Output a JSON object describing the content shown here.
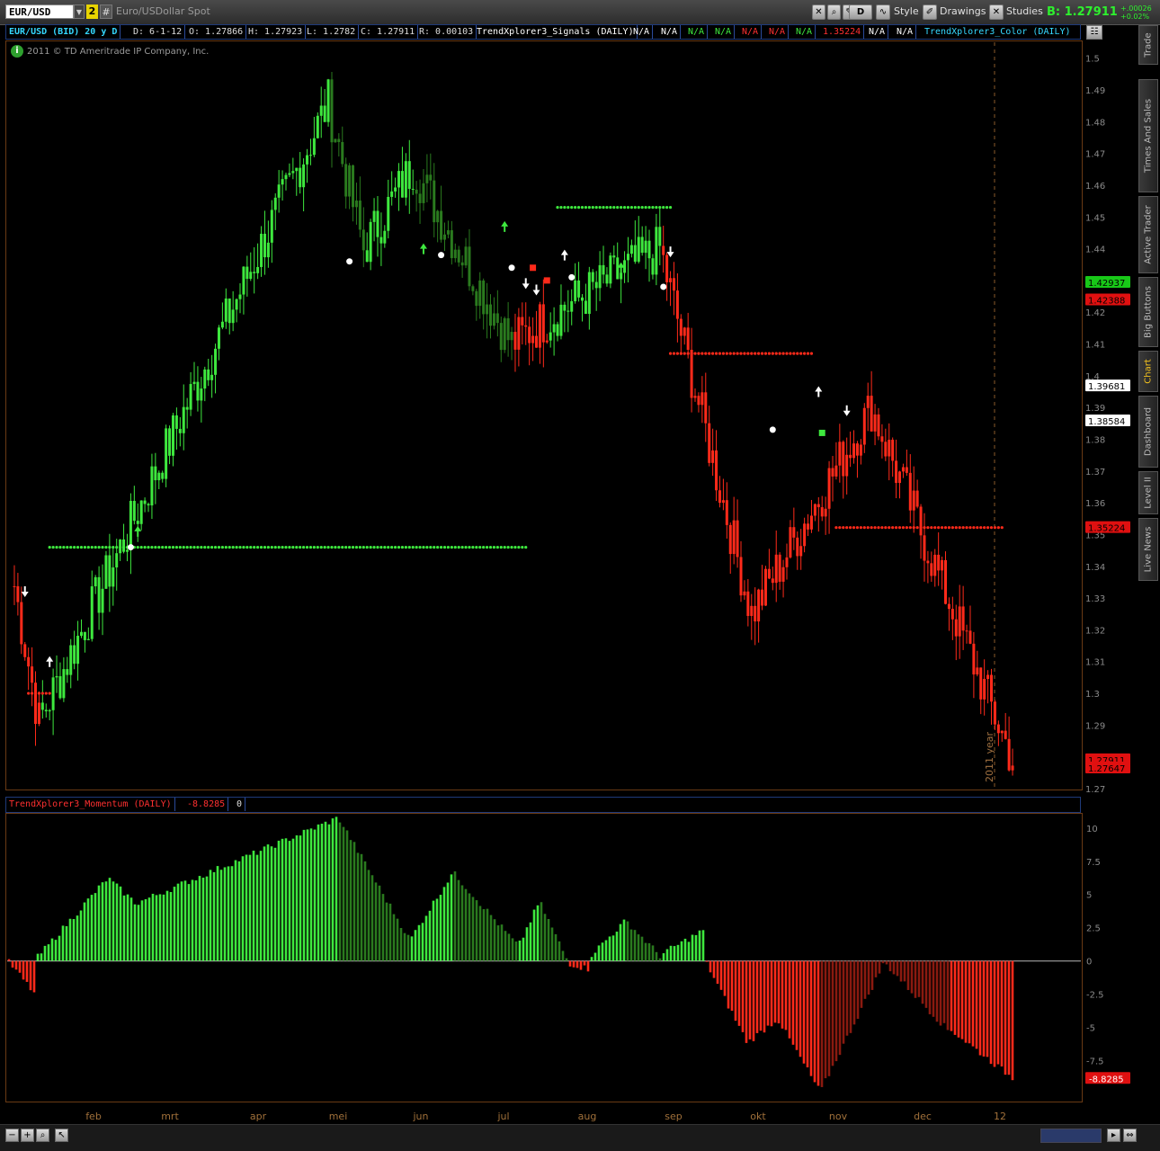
{
  "header": {
    "symbol": "EUR/USD",
    "link_badge": "2",
    "hash": "#",
    "description": "Euro/USDollar Spot",
    "period_button": "D",
    "style_label": "Style",
    "drawings_label": "Drawings",
    "studies_label": "Studies",
    "bid_label": "B: 1.27911",
    "change_abs": "+.00026",
    "change_pct": "+0.02%"
  },
  "infobar": {
    "title": "EUR/USD (BID) 20 y D",
    "date": "D: 6-1-12",
    "open": "O: 1.27866",
    "high": "H: 1.27923",
    "low": "L: 1.2782",
    "close": "C: 1.27911",
    "range": "R: 0.00103",
    "signals_study": "TrendXplorer3_Signals (DAILY)",
    "na_values": [
      "N/A",
      "N/A",
      "N/A",
      "N/A",
      "N/A",
      "N/A"
    ],
    "value_1": "1.35224",
    "na_values_2": [
      "N/A",
      "N/A"
    ],
    "color_study": "TrendXplorer3_Color (DAILY)"
  },
  "copyright": "2011 © TD Ameritrade IP Company, Inc.",
  "right_tabs": [
    "Trade",
    "Times And Sales",
    "Active Trader",
    "Big Buttons",
    "Chart",
    "Dashboard",
    "Level II",
    "Live News"
  ],
  "momentum_header": {
    "title": "TrendXplorer3_Momentum (DAILY)",
    "value": "-8.8285",
    "zero": "0"
  },
  "year_marker": "2011 year",
  "colors": {
    "bull": "#3ee83e",
    "bull_dark": "#2a7a1e",
    "bear": "#ff2a1a",
    "bear_dark": "#8a1a10",
    "axis_text": "#8a8a8a",
    "month_text": "#a0703a"
  },
  "chart_data": [
    {
      "type": "candlestick",
      "title": "EUR/USD (BID) 20 y D",
      "ylim": [
        1.27,
        1.505
      ],
      "y_ticks": [
        1.27,
        1.28,
        1.29,
        1.3,
        1.31,
        1.32,
        1.33,
        1.34,
        1.35,
        1.36,
        1.37,
        1.38,
        1.39,
        1.4,
        1.41,
        1.42,
        1.43,
        1.44,
        1.45,
        1.46,
        1.47,
        1.48,
        1.49,
        1.5
      ],
      "x_labels": [
        "feb",
        "mrt",
        "apr",
        "mei",
        "jun",
        "jul",
        "aug",
        "sep",
        "okt",
        "nov",
        "dec",
        "12"
      ],
      "price_bubbles": [
        {
          "value": "1.42937",
          "bg": "#18c818",
          "fg": "#000"
        },
        {
          "value": "1.42388",
          "bg": "#e01010",
          "fg": "#000"
        },
        {
          "value": "1.39681",
          "bg": "#ffffff",
          "fg": "#000"
        },
        {
          "value": "1.38584",
          "bg": "#ffffff",
          "fg": "#000"
        },
        {
          "value": "1.35224",
          "bg": "#e01010",
          "fg": "#000"
        },
        {
          "value": "1.27911",
          "bg": "#e01010",
          "fg": "#000"
        },
        {
          "value": "1.27647",
          "bg": "#e01010",
          "fg": "#000"
        }
      ],
      "series_segments": [
        {
          "phase": "bear",
          "from": 1.34,
          "to": 1.291
        },
        {
          "phase": "bull",
          "from": 1.291,
          "to": 1.486
        },
        {
          "phase": "bull-weak",
          "from": 1.486,
          "to": 1.44
        },
        {
          "phase": "bull",
          "from": 1.44,
          "to": 1.466
        },
        {
          "phase": "bull-weak",
          "from": 1.466,
          "to": 1.41
        },
        {
          "phase": "bear",
          "from": 1.41,
          "to": 1.418
        },
        {
          "phase": "bull",
          "from": 1.418,
          "to": 1.44
        },
        {
          "phase": "bear",
          "from": 1.44,
          "to": 1.325
        },
        {
          "phase": "bear",
          "from": 1.325,
          "to": 1.39
        },
        {
          "phase": "bear",
          "from": 1.39,
          "to": 1.279
        }
      ],
      "support_lines": [
        {
          "color": "bull",
          "y": 1.346,
          "from_day": 10,
          "to_day": 145
        },
        {
          "color": "bull",
          "y": 1.453,
          "from_day": 154,
          "to_day": 186
        },
        {
          "color": "bear",
          "y": 1.3,
          "from_day": 4,
          "to_day": 10
        },
        {
          "color": "bear",
          "y": 1.407,
          "from_day": 186,
          "to_day": 226
        },
        {
          "color": "bear",
          "y": 1.3522,
          "from_day": 233,
          "to_day": 280
        }
      ],
      "signals": [
        {
          "kind": "arrow-down-white",
          "day": 3,
          "y": 1.332
        },
        {
          "kind": "arrow-up-white",
          "day": 10,
          "y": 1.31
        },
        {
          "kind": "arrow-up-green",
          "day": 35,
          "y": 1.351
        },
        {
          "kind": "dot-white",
          "day": 33,
          "y": 1.346
        },
        {
          "kind": "dot-white",
          "day": 95,
          "y": 1.436
        },
        {
          "kind": "arrow-up-green",
          "day": 116,
          "y": 1.44
        },
        {
          "kind": "dot-white",
          "day": 121,
          "y": 1.438
        },
        {
          "kind": "arrow-up-green",
          "day": 139,
          "y": 1.447
        },
        {
          "kind": "dot-white",
          "day": 141,
          "y": 1.434
        },
        {
          "kind": "arrow-down-white",
          "day": 145,
          "y": 1.429
        },
        {
          "kind": "square-red",
          "day": 147,
          "y": 1.434
        },
        {
          "kind": "arrow-down-white",
          "day": 148,
          "y": 1.427
        },
        {
          "kind": "square-red",
          "day": 151,
          "y": 1.43
        },
        {
          "kind": "arrow-up-white",
          "day": 156,
          "y": 1.438
        },
        {
          "kind": "dot-white",
          "day": 158,
          "y": 1.431
        },
        {
          "kind": "arrow-up-green",
          "day": 172,
          "y": 1.434
        },
        {
          "kind": "dot-white",
          "day": 184,
          "y": 1.428
        },
        {
          "kind": "arrow-down-white",
          "day": 186,
          "y": 1.439
        },
        {
          "kind": "dot-white",
          "day": 215,
          "y": 1.383
        },
        {
          "kind": "arrow-up-white",
          "day": 228,
          "y": 1.395
        },
        {
          "kind": "square-green",
          "day": 229,
          "y": 1.382
        },
        {
          "kind": "arrow-down-white",
          "day": 236,
          "y": 1.389
        }
      ]
    },
    {
      "type": "bar",
      "title": "TrendXplorer3_Momentum (DAILY)",
      "ylim": [
        -10.5,
        11
      ],
      "y_ticks": [
        -7.5,
        -5,
        -2.5,
        0,
        2.5,
        5,
        7.5,
        10
      ],
      "last_value": -8.8285,
      "series_segments": [
        {
          "phase": "bear",
          "from": -0.1,
          "to": -2.4,
          "days": 8
        },
        {
          "phase": "bull",
          "from": 0.3,
          "to": 6.1,
          "days": 20
        },
        {
          "phase": "bull",
          "from": 6.1,
          "to": 4.4,
          "days": 8
        },
        {
          "phase": "bull",
          "from": 4.4,
          "to": 10.7,
          "days": 56
        },
        {
          "phase": "bull-weak",
          "from": 10.6,
          "to": 1.8,
          "days": 20
        },
        {
          "phase": "bull",
          "from": 1.8,
          "to": 6.5,
          "days": 12
        },
        {
          "phase": "bull-weak",
          "from": 6.5,
          "to": 1.3,
          "days": 18
        },
        {
          "phase": "bull",
          "from": 1.3,
          "to": 4.2,
          "days": 6
        },
        {
          "phase": "bull-weak",
          "from": 4.2,
          "to": 0.2,
          "days": 8
        },
        {
          "phase": "bear",
          "from": -0.2,
          "to": -0.6,
          "days": 6
        },
        {
          "phase": "bull",
          "from": 0.5,
          "to": 2.9,
          "days": 10
        },
        {
          "phase": "bull-weak",
          "from": 2.9,
          "to": 0.4,
          "days": 10
        },
        {
          "phase": "bull",
          "from": 0.6,
          "to": 2.3,
          "days": 12
        },
        {
          "phase": "bear",
          "from": -0.2,
          "to": -6.0,
          "days": 12
        },
        {
          "phase": "bear",
          "from": -6.0,
          "to": -4.5,
          "days": 8
        },
        {
          "phase": "bear",
          "from": -4.5,
          "to": -9.6,
          "days": 12
        },
        {
          "phase": "bear-weak",
          "from": -9.6,
          "to": -0.3,
          "days": 18
        },
        {
          "phase": "bear-weak",
          "from": -0.3,
          "to": -5.2,
          "days": 18
        },
        {
          "phase": "bear",
          "from": -5.2,
          "to": -8.8,
          "days": 18
        }
      ]
    }
  ]
}
